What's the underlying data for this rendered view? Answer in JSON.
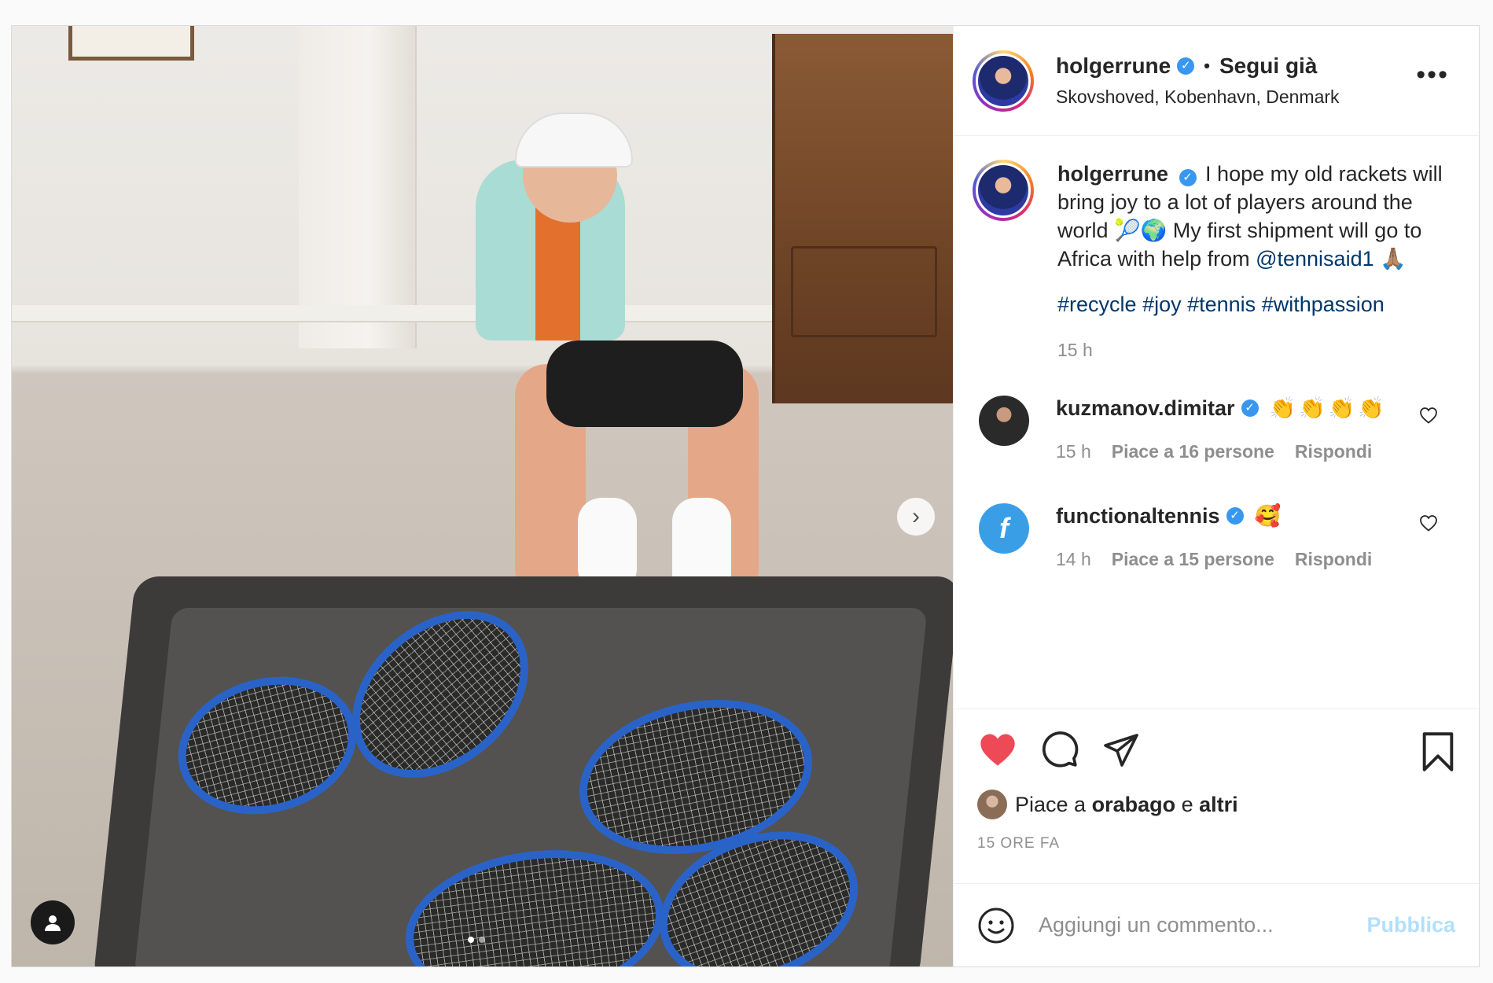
{
  "header": {
    "username": "holgerrune",
    "separator": "•",
    "follow_label": "Segui già",
    "location": "Skovshoved, Kobenhavn, Denmark",
    "more_icon": "more-horizontal-icon"
  },
  "caption": {
    "username": "holgerrune",
    "text_part1": "I hope my old rackets will bring joy to a lot of players around the world 🎾🌍 My first shipment will go to Africa with help from ",
    "mention": "@tennisaid1",
    "text_part2": " 🙏🏽",
    "hashtags": [
      "#recycle",
      "#joy",
      "#tennis",
      "#withpassion"
    ],
    "time": "15 h"
  },
  "comments": [
    {
      "username": "kuzmanov.dimitar",
      "text": "👏👏👏👏",
      "time": "15 h",
      "likes": "Piace a 16 persone",
      "reply": "Rispondi"
    },
    {
      "username": "functionaltennis",
      "text": "🥰",
      "time": "14 h",
      "likes": "Piace a 15 persone",
      "reply": "Rispondi"
    }
  ],
  "actions": {
    "liked_prefix": "Piace a",
    "liked_user": "orabago",
    "liked_joiner": "e",
    "liked_others": "altri",
    "posted_ago": "15 ORE FA"
  },
  "add_comment": {
    "placeholder": "Aggiungi un commento...",
    "publish": "Pubblica"
  },
  "media": {
    "carousel_index": 1,
    "carousel_count": 2,
    "next_icon": "chevron-right-icon",
    "tag_icon": "user-tag-icon"
  },
  "colors": {
    "like_red": "#ed4956",
    "link_blue": "#00376b",
    "verified_blue": "#3897f0",
    "publish_disabled": "#b2dffc"
  }
}
